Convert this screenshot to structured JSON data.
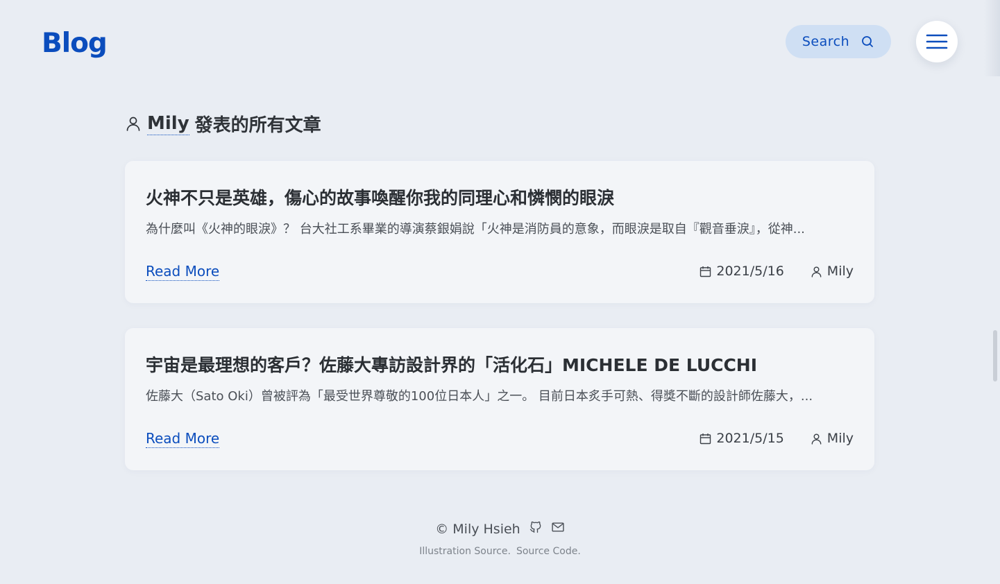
{
  "header": {
    "logo": "Blog",
    "search_label": "Search"
  },
  "author_page": {
    "author_name": "Mily",
    "heading_suffix": "發表的所有文章"
  },
  "posts": [
    {
      "title": "火神不只是英雄，傷心的故事喚醒你我的同理心和憐憫的眼淚",
      "excerpt": "為什麼叫《火神的眼淚》？ 台大社工系畢業的導演蔡銀娟說「火神是消防員的意象，而眼淚是取自『觀音垂淚』，從神...",
      "read_more": "Read More",
      "date": "2021/5/16",
      "author": "Mily"
    },
    {
      "title": "宇宙是最理想的客戶？佐藤大專訪設計界的「活化石」MICHELE DE LUCCHI",
      "excerpt": "佐藤大（Sato Oki）曾被評為「最受世界尊敬的100位日本人」之一。 目前日本炙手可熱、得獎不斷的設計師佐藤大，...",
      "read_more": "Read More",
      "date": "2021/5/15",
      "author": "Mily"
    }
  ],
  "footer": {
    "copyright": "© Mily Hsieh",
    "illustration_link": "Illustration Source.",
    "source_link": "Source Code."
  },
  "icons": {
    "search": "search-icon",
    "menu": "hamburger-menu-icon",
    "user": "user-icon",
    "calendar": "calendar-icon",
    "github": "github-icon",
    "mail": "mail-icon"
  },
  "colors": {
    "accent": "#0b4dbd",
    "background": "#e9edf3",
    "card": "#f3f5f8",
    "search_bg": "#cfdff3"
  }
}
